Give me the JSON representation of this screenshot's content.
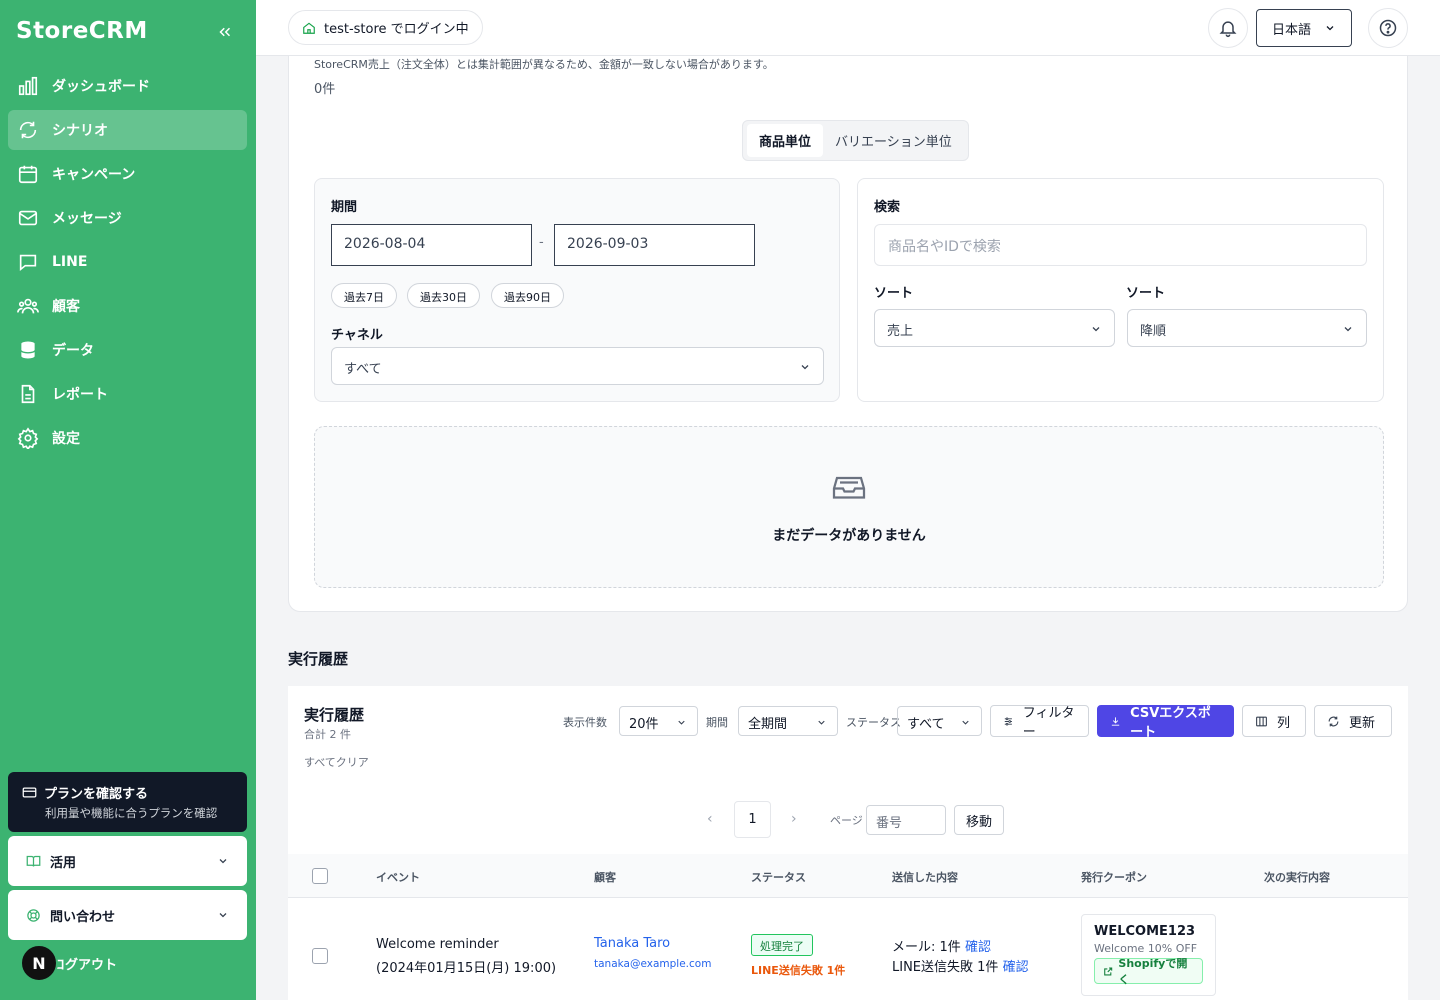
{
  "sidebar": {
    "logo": "StoreCRM",
    "collapse_icon": "chevrons-left-icon",
    "items": [
      {
        "label": "ダッシュボード",
        "icon": "bar-chart-icon"
      },
      {
        "label": "シナリオ",
        "icon": "refresh-icon",
        "active": true
      },
      {
        "label": "キャンペーン",
        "icon": "calendar-icon"
      },
      {
        "label": "メッセージ",
        "icon": "mail-icon"
      },
      {
        "label": "LINE",
        "icon": "chat-icon"
      },
      {
        "label": "顧客",
        "icon": "users-icon"
      },
      {
        "label": "データ",
        "icon": "database-icon"
      },
      {
        "label": "レポート",
        "icon": "file-icon"
      },
      {
        "label": "設定",
        "icon": "gear-icon"
      }
    ],
    "plan": {
      "title": "プランを確認する",
      "subtitle": "利用量や機能に合うプランを確認"
    },
    "accordions": [
      {
        "label": "活用"
      },
      {
        "label": "問い合わせ"
      }
    ],
    "logout": {
      "avatar": "N",
      "label": "ログアウト"
    }
  },
  "topbar": {
    "store": "test-store でログイン中",
    "language": "日本語"
  },
  "products": {
    "note": "StoreCRM売上（注文全体）とは集計範囲が異なるため、金額が一致しない場合があります。",
    "count": "0件",
    "segments": [
      "商品単位",
      "バリエーション単位"
    ],
    "period_label": "期間",
    "date_from": "2026-08-04",
    "date_to": "2026-09-03",
    "date_sep": "-",
    "quick_ranges": [
      "過去7日",
      "過去30日",
      "過去90日"
    ],
    "channel_label": "チャネル",
    "channel_value": "すべて",
    "search_label": "検索",
    "search_placeholder": "商品名やIDで検索",
    "sort1_label": "ソート",
    "sort1_value": "売上",
    "sort2_label": "ソート",
    "sort2_value": "降順",
    "empty_text": "まだデータがありません"
  },
  "history": {
    "section_title": "実行履歴",
    "title": "実行履歴",
    "total": "合計 2 件",
    "clear_all": "すべてクリア",
    "per_page_label": "表示件数",
    "per_page_value": "20件",
    "period_label": "期間",
    "period_value": "全期間",
    "status_label": "ステータス",
    "status_value": "すべて",
    "filter_btn": "フィルター",
    "csv_btn": "CSVエクスポート",
    "columns_btn": "列",
    "refresh_btn": "更新",
    "pager": {
      "prev": "‹",
      "page": "1",
      "next": "›",
      "page_label": "ページ",
      "page_placeholder": "番号",
      "go": "移動"
    },
    "columns": [
      "イベント",
      "顧客",
      "ステータス",
      "送信した内容",
      "発行クーポン",
      "次の実行内容"
    ],
    "rows": [
      {
        "event": "Welcome reminder",
        "event_time": "(2024年01月15日(月) 19:00)",
        "customer_name": "Tanaka Taro",
        "customer_email": "tanaka@example.com",
        "status": "処理完了",
        "status_fail": "LINE送信失敗 1件",
        "sent_mail": "メール: 1件",
        "sent_line": "LINE送信失敗 1件",
        "confirm": "確認",
        "coupon_code": "WELCOME123",
        "coupon_desc": "Welcome 10% OFF",
        "coupon_btn": "Shopifyで開く"
      }
    ]
  }
}
